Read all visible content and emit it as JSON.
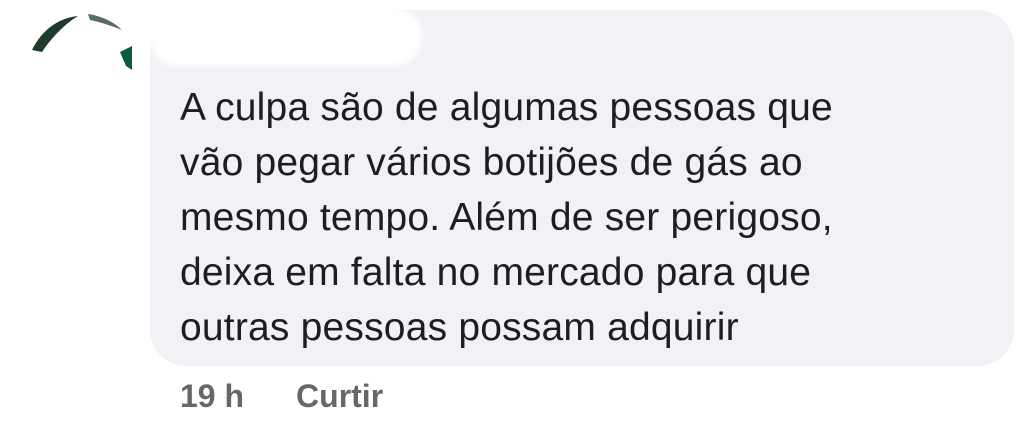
{
  "comment": {
    "text": "A culpa são de algumas pessoas que\nvão pegar vários botijões de gás ao\nmesmo tempo. Além de ser perigoso,\ndeixa em falta no mercado para que\noutras pessoas possam adquirir",
    "timestamp": "19 h",
    "like_label": "Curtir"
  },
  "colors": {
    "bubble": "#f0f2f5",
    "text": "#1c1e21",
    "meta": "#65676b"
  },
  "icons": {
    "avatar": "avatar"
  }
}
